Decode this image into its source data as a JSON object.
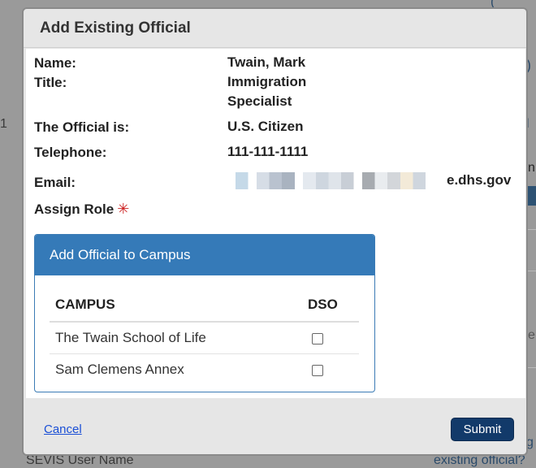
{
  "background": {
    "fragment_number": "1",
    "sevis_user_name": "SEVIS User Name",
    "existing_official_link": "existing official?",
    "edge_fragment_paren": ")",
    "edge_fragment_l": "l",
    "edge_fragment_n": "n",
    "edge_fragment_e": "e",
    "edge_fragment_g": "g",
    "edge_fragment_top": "("
  },
  "modal": {
    "title": "Add Existing Official",
    "details": {
      "name_label": "Name:",
      "name_value": "Twain, Mark",
      "title_label": "Title:",
      "title_value_line1": "Immigration",
      "title_value_line2": "Specialist",
      "official_is_label": "The Official is:",
      "official_is_value": "U.S. Citizen",
      "telephone_label": "Telephone:",
      "telephone_value": "111-111-1111",
      "email_label": "Email:",
      "email_visible_suffix": "e.dhs.gov",
      "assign_role_label": "Assign Role",
      "required_icon": "required-asterisk-icon"
    },
    "campus_panel": {
      "heading": "Add Official to Campus",
      "columns": [
        "CAMPUS",
        "DSO"
      ],
      "rows": [
        {
          "campus": "The Twain School of Life",
          "dso_checked": false
        },
        {
          "campus": "Sam Clemens Annex",
          "dso_checked": false
        }
      ]
    },
    "footer": {
      "cancel_label": "Cancel",
      "submit_label": "Submit"
    }
  },
  "colors": {
    "panel_header": "#357ab8",
    "submit_button": "#123a6a",
    "link": "#1a4fd6",
    "required": "#cc2222"
  }
}
